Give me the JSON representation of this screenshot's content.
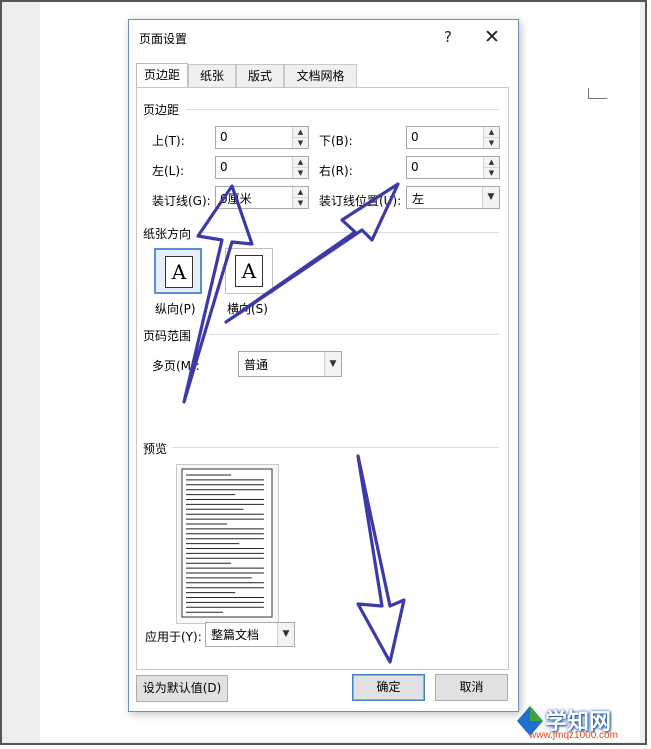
{
  "dialog": {
    "title": "页面设置",
    "help_glyph": "?",
    "close_glyph": "✕"
  },
  "tabs": [
    {
      "label": "页边距",
      "active": true
    },
    {
      "label": "纸张",
      "active": false
    },
    {
      "label": "版式",
      "active": false
    },
    {
      "label": "文档网格",
      "active": false
    }
  ],
  "margins": {
    "section_title": "页边距",
    "top": {
      "label": "上(T):",
      "value": "0"
    },
    "bottom": {
      "label": "下(B):",
      "value": "0"
    },
    "left": {
      "label": "左(L):",
      "value": "0"
    },
    "right": {
      "label": "右(R):",
      "value": "0"
    },
    "gutter": {
      "label": "装订线(G):",
      "value": "0厘米"
    },
    "gutter_position": {
      "label": "装订线位置(U):",
      "value": "左"
    }
  },
  "orientation": {
    "section_title": "纸张方向",
    "portrait_label": "纵向(P)",
    "landscape_label": "横向(S)",
    "glyph": "A",
    "selected": "portrait"
  },
  "pages": {
    "section_title": "页码范围",
    "multiple_label": "多页(M):",
    "multiple_value": "普通"
  },
  "preview": {
    "section_title": "预览",
    "apply_label": "应用于(Y):",
    "apply_value": "整篇文档"
  },
  "buttons": {
    "set_default": "设为默认值(D)",
    "ok": "确定",
    "cancel": "取消"
  },
  "spin_glyphs": {
    "up": "▲",
    "down": "▼",
    "drop": "▼"
  },
  "watermark": {
    "logo_text": "学知网",
    "url": "www.jmqz1000.com"
  },
  "colors": {
    "annotation_arrow": "#3d3aa8",
    "selection_blue": "#5b8ed6",
    "dialog_border": "#6c8cc4"
  }
}
